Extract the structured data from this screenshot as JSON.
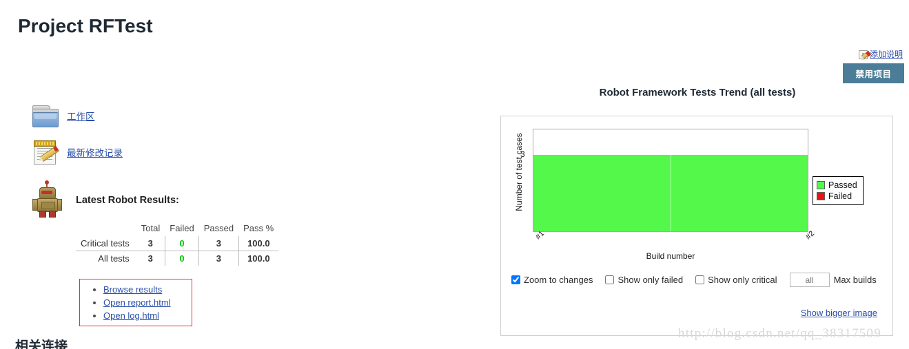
{
  "page": {
    "title": "Project RFTest",
    "related_links_heading": "相关连接"
  },
  "actions": {
    "add_description_label": "添加说明",
    "add_description_icon": "edit-note-icon",
    "disable_project_label": "禁用项目",
    "disable_project_color": "#4b7d98"
  },
  "links": {
    "workspace": {
      "label": "工作区",
      "icon": "folder-icon"
    },
    "recent_changes": {
      "label": "最新修改记录",
      "icon": "notepad-pencil-icon"
    }
  },
  "results": {
    "icon": "robot-icon",
    "heading": "Latest Robot Results:",
    "columns": [
      "Total",
      "Failed",
      "Passed",
      "Pass %"
    ],
    "rows": [
      {
        "label": "Critical tests",
        "total": "3",
        "failed": "0",
        "passed": "3",
        "pass_pct": "100.0"
      },
      {
        "label": "All tests",
        "total": "3",
        "failed": "0",
        "passed": "3",
        "pass_pct": "100.0"
      }
    ],
    "zero_color": "#00c800",
    "box_border_color": "#e03030",
    "links": [
      {
        "label": "Browse results"
      },
      {
        "label": "Open report.html"
      },
      {
        "label": "Open log.html"
      }
    ]
  },
  "chart_panel": {
    "title": "Robot Framework Tests Trend (all tests)",
    "controls": {
      "zoom_to_changes": {
        "label": "Zoom to changes",
        "checked": true
      },
      "show_only_failed": {
        "label": "Show only failed",
        "checked": false
      },
      "show_only_critical": {
        "label": "Show only critical",
        "checked": false
      },
      "max_builds": {
        "label": "Max builds",
        "placeholder": "all",
        "value": ""
      }
    },
    "show_bigger_image_label": "Show bigger image"
  },
  "chart_data": {
    "type": "area",
    "title": "Robot Framework Tests Trend (all tests)",
    "xlabel": "Build number",
    "ylabel": "Number of test cases",
    "x": [
      "#1",
      "#2"
    ],
    "categories": [
      "#1",
      "#2"
    ],
    "series": [
      {
        "name": "Passed",
        "color": "#54f84a",
        "values": [
          3,
          3
        ]
      },
      {
        "name": "Failed",
        "color": "#ee1111",
        "values": [
          0,
          0
        ]
      }
    ],
    "ytick_labels": [
      "3"
    ],
    "yticks": [
      3
    ],
    "ylim": [
      0,
      4
    ],
    "grid": false,
    "legend_position": "right",
    "legend": [
      "Passed",
      "Failed"
    ]
  },
  "watermark": {
    "text": "http://blog.csdn.net/qq_38317509"
  }
}
